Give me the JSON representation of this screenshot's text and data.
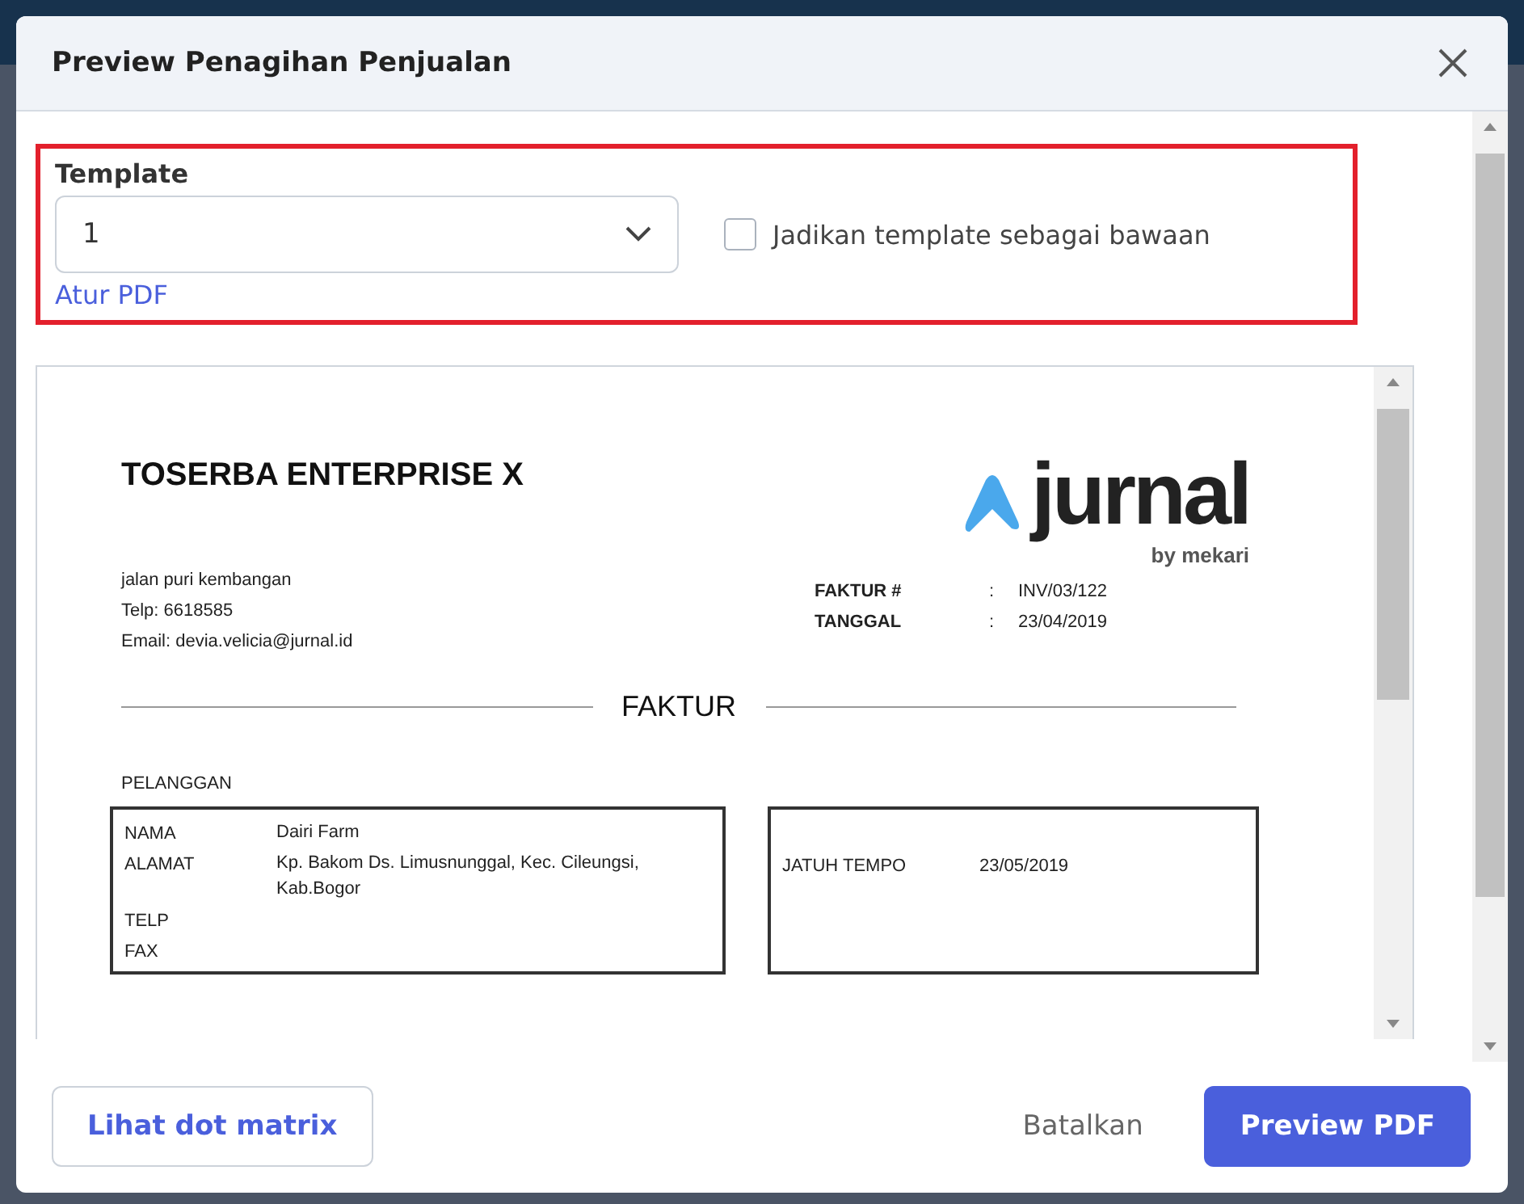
{
  "dialog": {
    "title": "Preview Penagihan Penjualan"
  },
  "template": {
    "label": "Template",
    "value": "1",
    "default_checkbox": {
      "label": "Jadikan template sebagai bawaan",
      "checked": false
    },
    "link": "Atur PDF"
  },
  "preview": {
    "company": "TOSERBA ENTERPRISE X",
    "address_lines": [
      "jalan puri kembangan",
      "Telp: 6618585",
      "Email: devia.velicia@jurnal.id"
    ],
    "logo": {
      "word": "jurnal",
      "byline": "by mekari"
    },
    "meta": [
      {
        "label": "FAKTUR #",
        "sep": ":",
        "value": "INV/03/122"
      },
      {
        "label": "TANGGAL",
        "sep": ":",
        "value": "23/04/2019"
      }
    ],
    "heading": "FAKTUR",
    "customer_label": "PELANGGAN",
    "customer": [
      {
        "label": "NAMA",
        "value": "Dairi Farm"
      },
      {
        "label": "ALAMAT",
        "value": "Kp. Bakom Ds. Limusnunggal, Kec. Cileungsi, Kab.Bogor"
      },
      {
        "label": "TELP"
      },
      {
        "label": "FAX"
      }
    ],
    "due": [
      {
        "label": "JATUH TEMPO",
        "value": "23/05/2019"
      }
    ]
  },
  "footer": {
    "dot_matrix_button": "Lihat dot matrix",
    "cancel_button": "Batalkan",
    "preview_button": "Preview PDF"
  }
}
